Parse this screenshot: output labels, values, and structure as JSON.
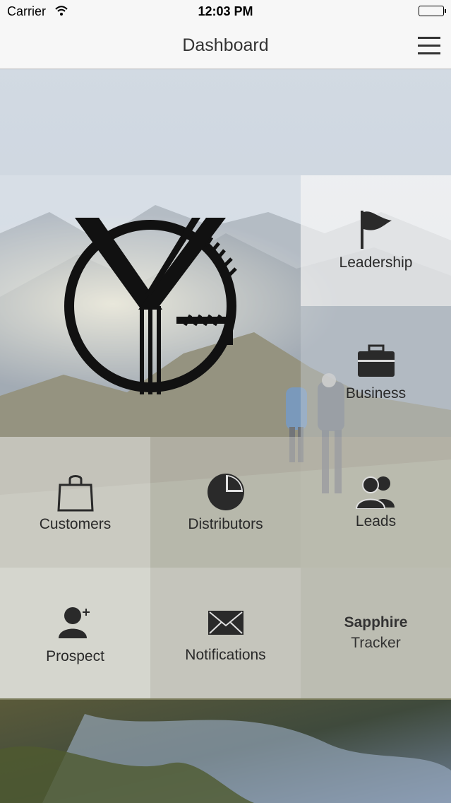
{
  "status_bar": {
    "carrier": "Carrier",
    "time": "12:03 PM"
  },
  "nav": {
    "title": "Dashboard"
  },
  "tiles": {
    "leadership": "Leadership",
    "business": "Business",
    "customers": "Customers",
    "distributors": "Distributors",
    "leads": "Leads",
    "prospect": "Prospect",
    "notifications": "Notifications",
    "sapphire_title": "Sapphire",
    "sapphire_sub": "Tracker"
  },
  "icons": {
    "wifi": "wifi-icon",
    "battery": "battery-icon",
    "menu": "hamburger-menu-icon",
    "leadership": "flag-icon",
    "business": "briefcase-icon",
    "customers": "shopping-bag-icon",
    "distributors": "pie-chart-icon",
    "leads": "users-icon",
    "prospect": "add-user-icon",
    "notifications": "envelope-icon"
  },
  "colors": {
    "icon": "#2a2a2a",
    "nav_bg": "#f7f7f7"
  }
}
